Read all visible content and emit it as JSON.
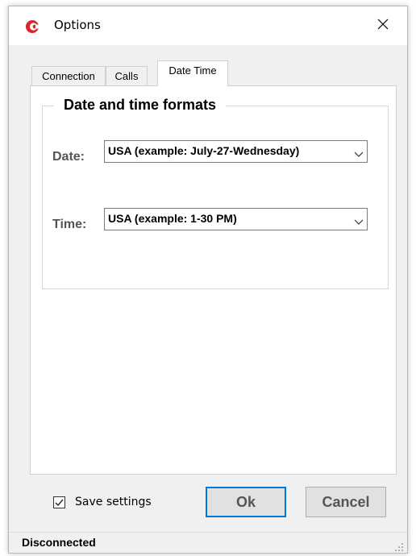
{
  "window": {
    "title": "Options",
    "app_icon": "circular-c-logo-icon",
    "close_icon": "close-icon"
  },
  "tabs": [
    {
      "label": "Connection",
      "active": false
    },
    {
      "label": "Calls",
      "active": false
    },
    {
      "label": "Date Time",
      "active": true
    }
  ],
  "datetime": {
    "group_title": "Date and time formats",
    "date_label": "Date:",
    "date_value": "USA (example: July-27-Wednesday)",
    "time_label": "Time:",
    "time_value": "USA (example: 1-30 PM)"
  },
  "footer": {
    "save_settings_label": "Save settings",
    "save_settings_checked": true,
    "ok_label": "Ok",
    "cancel_label": "Cancel"
  },
  "status": {
    "text": "Disconnected"
  },
  "colors": {
    "brand": "#d8262c",
    "focus_border": "#0078d7",
    "dialog_bg": "#f0f0f0"
  }
}
